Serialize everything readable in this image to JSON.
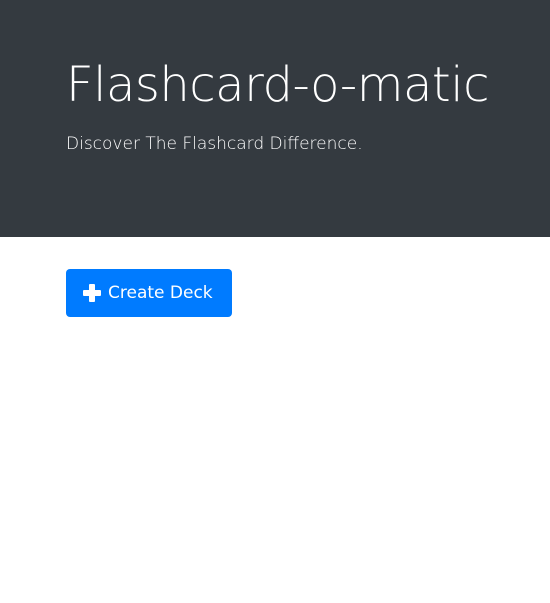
{
  "header": {
    "title": "Flashcard-o-matic",
    "subtitle": "Discover The Flashcard Difference."
  },
  "actions": {
    "create_deck_label": "Create Deck",
    "create_deck_icon": "plus-icon"
  },
  "colors": {
    "header_background": "#343a40",
    "primary_button": "#007bff",
    "text_on_dark": "#ffffff"
  }
}
